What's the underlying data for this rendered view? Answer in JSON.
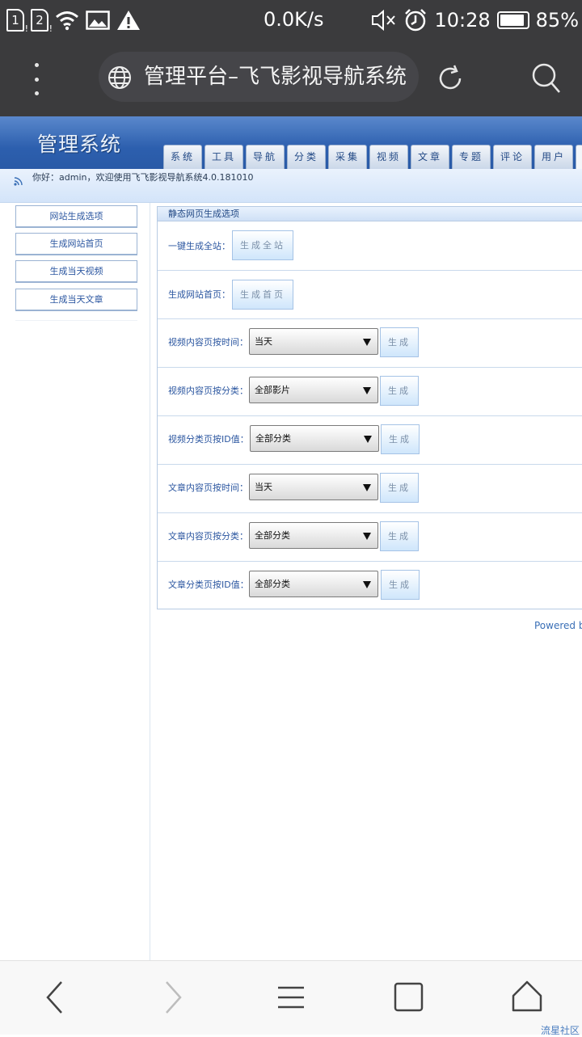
{
  "status_bar": {
    "sim1": "1",
    "sim2": "2",
    "sim_badge": "!",
    "network_speed": "0.0K/s",
    "time": "10:28",
    "battery": "85%",
    "icons": [
      "sim1-icon",
      "sim2-icon",
      "wifi-icon",
      "image-icon",
      "warning-icon",
      "mute-icon",
      "alarm-icon",
      "battery-icon"
    ]
  },
  "browser": {
    "page_title": "管理平台–飞飞影视导航系统",
    "icons": [
      "menu-dots-icon",
      "globe-icon",
      "reload-icon",
      "search-icon"
    ]
  },
  "header": {
    "brand": "管理系统",
    "tabs": [
      "系统",
      "工具",
      "导航",
      "分类",
      "采集",
      "视频",
      "文章",
      "专题",
      "评论",
      "用户"
    ],
    "welcome": "你好：admin，欢迎使用飞飞影视导航系统4.0.181010"
  },
  "sidebar": {
    "items": [
      "网站生成选项",
      "生成网站首页",
      "生成当天视频",
      "生成当天文章"
    ]
  },
  "main": {
    "panel_title": "静态网页生成选项",
    "rows": [
      {
        "label": "一键生成全站：",
        "button": "生成全站"
      },
      {
        "label": "生成网站首页：",
        "button": "生成首页"
      },
      {
        "label": "视频内容页按时间：",
        "select": "当天",
        "button": "生成"
      },
      {
        "label": "视频内容页按分类：",
        "select": "全部影片",
        "button": "生成"
      },
      {
        "label": "视频分类页按ID值：",
        "select": "全部分类",
        "button": "生成"
      },
      {
        "label": "文章内容页按时间：",
        "select": "当天",
        "button": "生成"
      },
      {
        "label": "文章内容页按分类：",
        "select": "全部分类",
        "button": "生成"
      },
      {
        "label": "文章分类页按ID值：",
        "select": "全部分类",
        "button": "生成"
      }
    ]
  },
  "footer": {
    "powered": "Powered by"
  },
  "bottom_nav": {
    "icons": [
      "back-icon",
      "forward-icon",
      "menu-icon",
      "tabs-icon",
      "home-icon"
    ]
  },
  "watermark": "流星社区"
}
